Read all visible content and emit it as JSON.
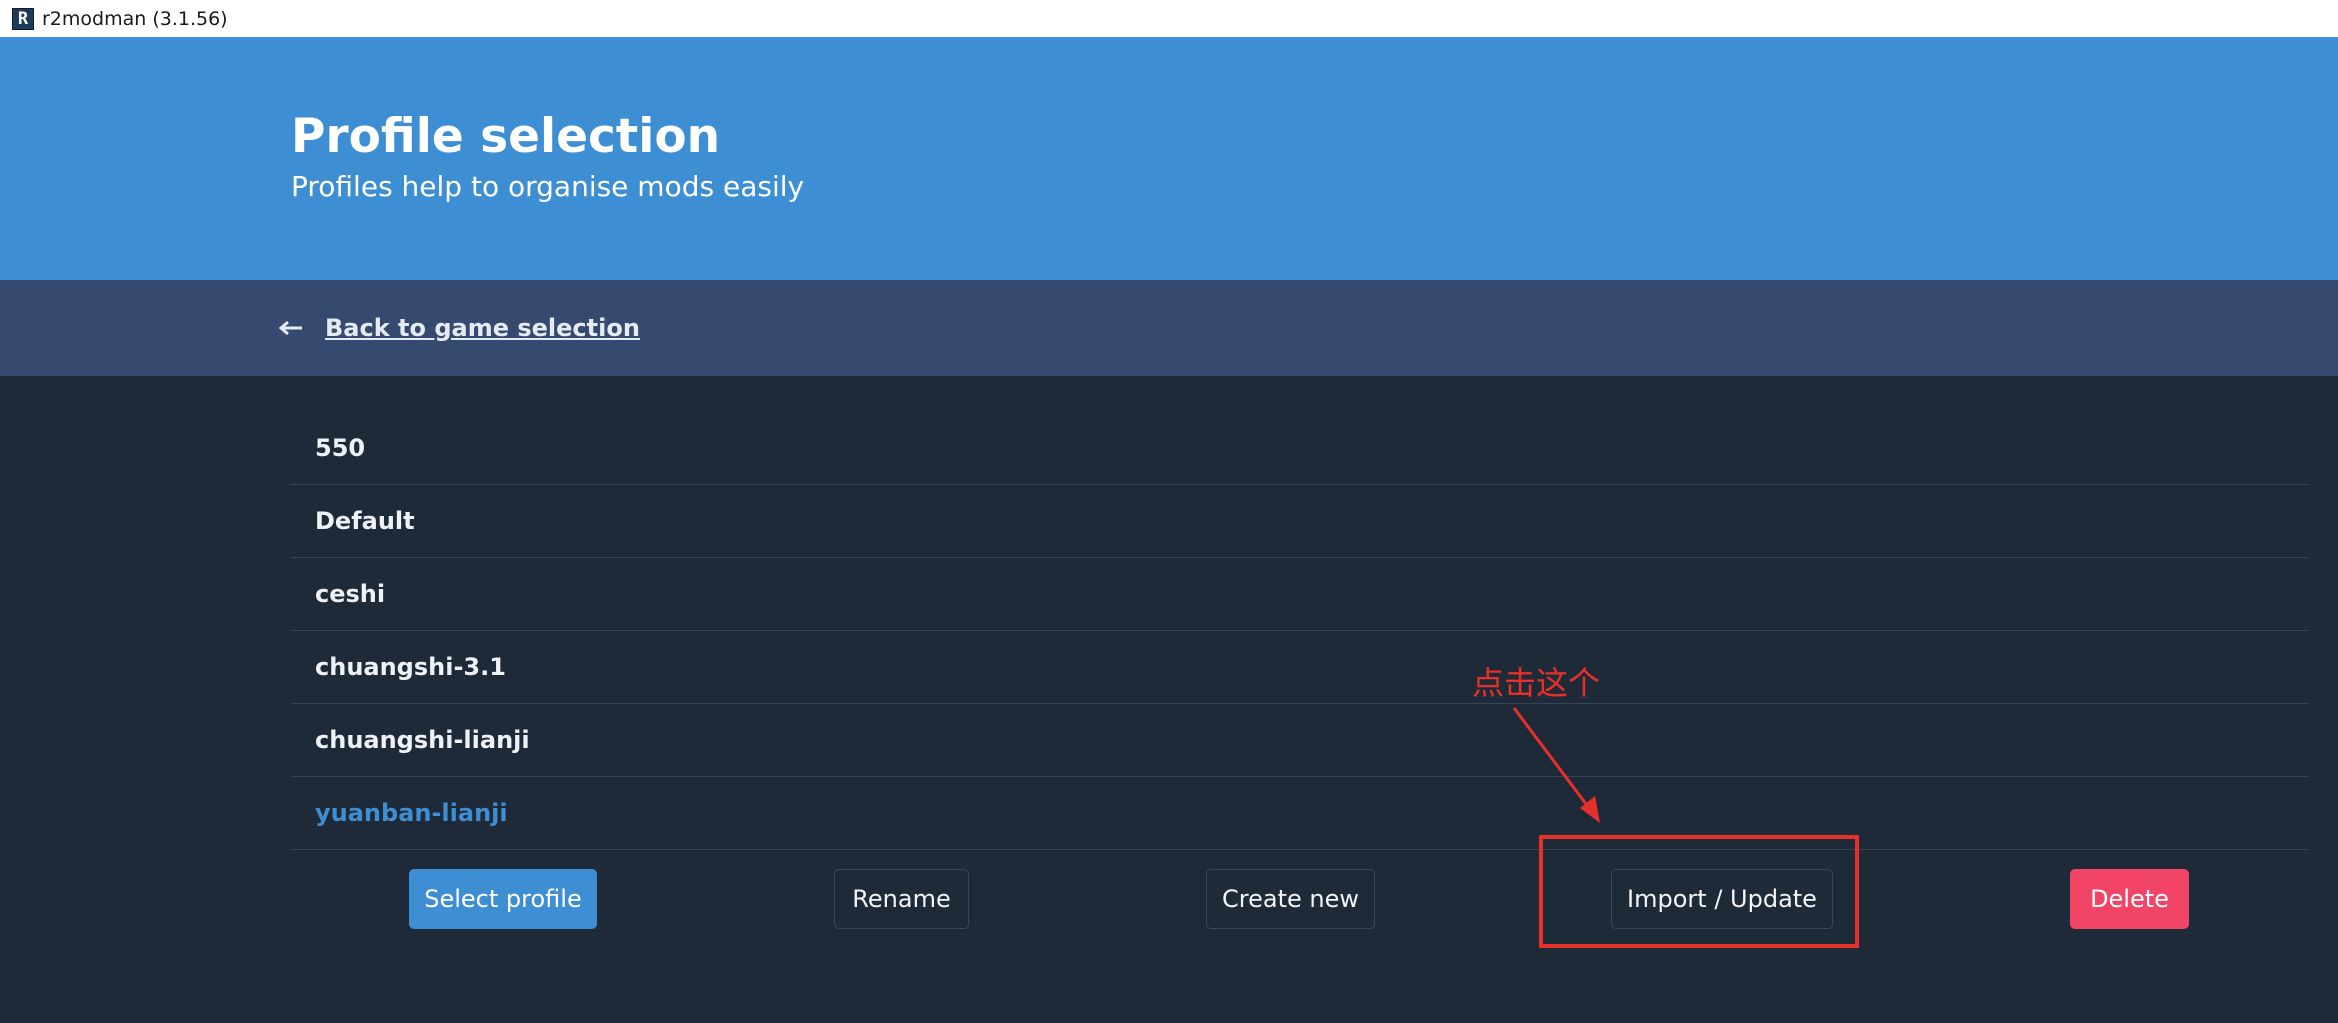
{
  "window": {
    "icon_letter": "R",
    "title": "r2modman (3.1.56)"
  },
  "header": {
    "title": "Profile selection",
    "subtitle": "Profiles help to organise mods easily"
  },
  "nav": {
    "back_label": "Back to game selection"
  },
  "profiles": {
    "items": [
      {
        "label": "550"
      },
      {
        "label": "Default"
      },
      {
        "label": "ceshi"
      },
      {
        "label": "chuangshi-3.1"
      },
      {
        "label": "chuangshi-lianji"
      },
      {
        "label": "yuanban-lianji"
      }
    ],
    "selected_index": 5
  },
  "actions": {
    "select_label": "Select profile",
    "rename_label": "Rename",
    "create_label": "Create new",
    "import_label": "Import / Update",
    "delete_label": "Delete"
  },
  "annotation": {
    "text": "点击这个",
    "color": "#e8302a"
  },
  "colors": {
    "accent": "#3e8ed3",
    "danger": "#f14467",
    "nav_bg": "#354a6e",
    "body_bg": "#1f2a38"
  }
}
